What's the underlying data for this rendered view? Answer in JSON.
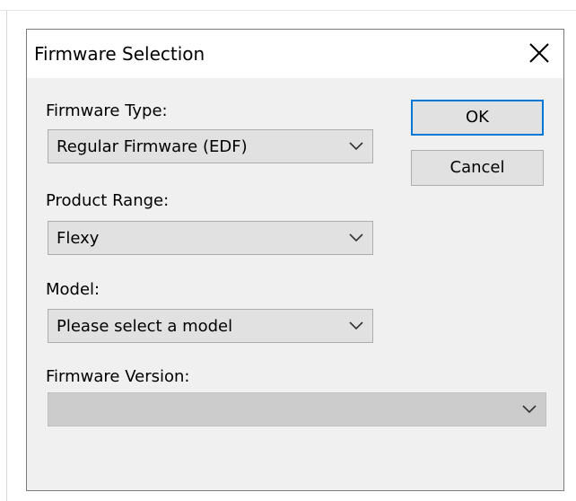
{
  "dialog": {
    "title": "Firmware Selection",
    "close_icon": "close-icon"
  },
  "fields": {
    "firmware_type": {
      "label": "Firmware Type:",
      "value": "Regular Firmware (EDF)"
    },
    "product_range": {
      "label": "Product Range:",
      "value": "Flexy"
    },
    "model": {
      "label": "Model:",
      "value": "Please select a model"
    },
    "firmware_version": {
      "label": "Firmware Version:",
      "value": ""
    }
  },
  "buttons": {
    "ok": "OK",
    "cancel": "Cancel"
  },
  "colors": {
    "focus_border": "#0078d7",
    "control_bg": "#e1e1e1",
    "disabled_bg": "#cccccc",
    "dialog_bg": "#f0f0f0"
  }
}
